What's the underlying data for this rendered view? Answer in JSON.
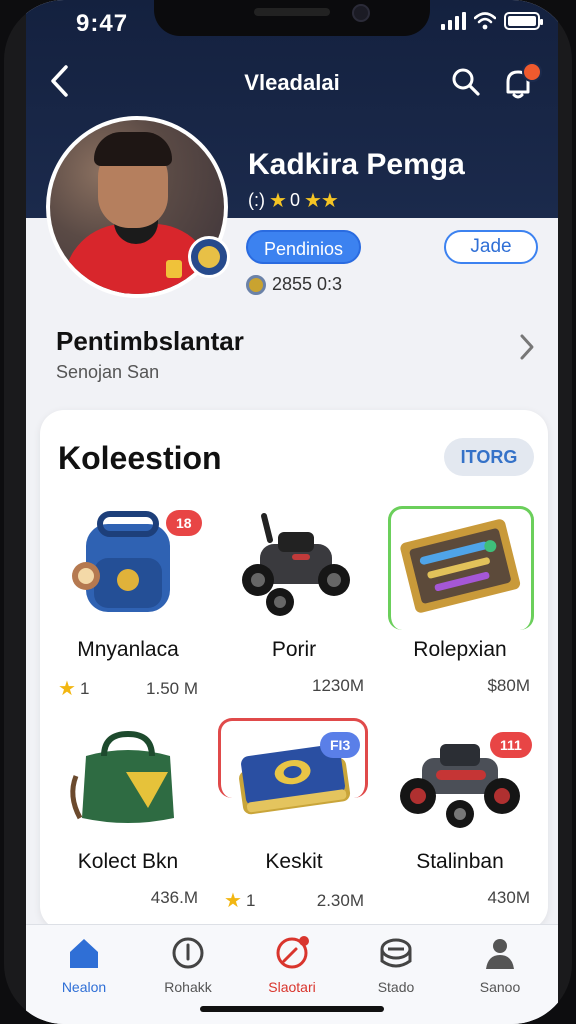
{
  "status_bar": {
    "time": "9:47"
  },
  "nav": {
    "title": "Vleadalai",
    "back_icon": "chevron-left-icon",
    "search_icon": "search-icon",
    "bell_icon": "bell-icon"
  },
  "profile": {
    "name": "Kadkira Pemga",
    "rating_prefix": "(:)",
    "rating_value": "0",
    "stars_before": "★",
    "stars_after": "★★",
    "tag_primary": "Pendinios",
    "tag_outline": "Jade",
    "coins": "2855 0:3"
  },
  "subsection": {
    "title": "Pentimbslantar",
    "subtitle": "Senojan San"
  },
  "collection": {
    "title": "Koleestion",
    "more_label": "ITORG",
    "items": [
      {
        "name": "Mnyanlaca",
        "star_count": "1",
        "price": "1.50 M",
        "tag": "18",
        "tag_color": "#e84545"
      },
      {
        "name": "Porir",
        "star_count": "",
        "price": "1230M",
        "tag": "",
        "tag_color": ""
      },
      {
        "name": "Rolepxian",
        "star_count": "",
        "price": "$80M",
        "tag": "",
        "tag_color": ""
      },
      {
        "name": "Kolect Bkn",
        "star_count": "",
        "price": "436.M",
        "tag": "",
        "tag_color": ""
      },
      {
        "name": "Keskit",
        "star_count": "1",
        "price": "2.30M",
        "tag": "FI3",
        "tag_color": "#5a7fe8"
      },
      {
        "name": "Stalinban",
        "star_count": "",
        "price": "430M",
        "tag": "111",
        "tag_color": "#e84545"
      }
    ]
  },
  "bottom_nav": {
    "tabs": [
      {
        "label": "Nealon",
        "icon": "home-icon",
        "active": true
      },
      {
        "label": "Rohakk",
        "icon": "compass-icon",
        "active": false
      },
      {
        "label": "Slaotari",
        "icon": "target-icon",
        "active": false,
        "alert": true
      },
      {
        "label": "Stado",
        "icon": "stadium-icon",
        "active": false
      },
      {
        "label": "Sanoo",
        "icon": "profile-icon",
        "active": false
      }
    ]
  },
  "colors": {
    "header": "#14213f",
    "accent": "#3c82f0",
    "star": "#f5c524",
    "alert": "#e84545"
  }
}
